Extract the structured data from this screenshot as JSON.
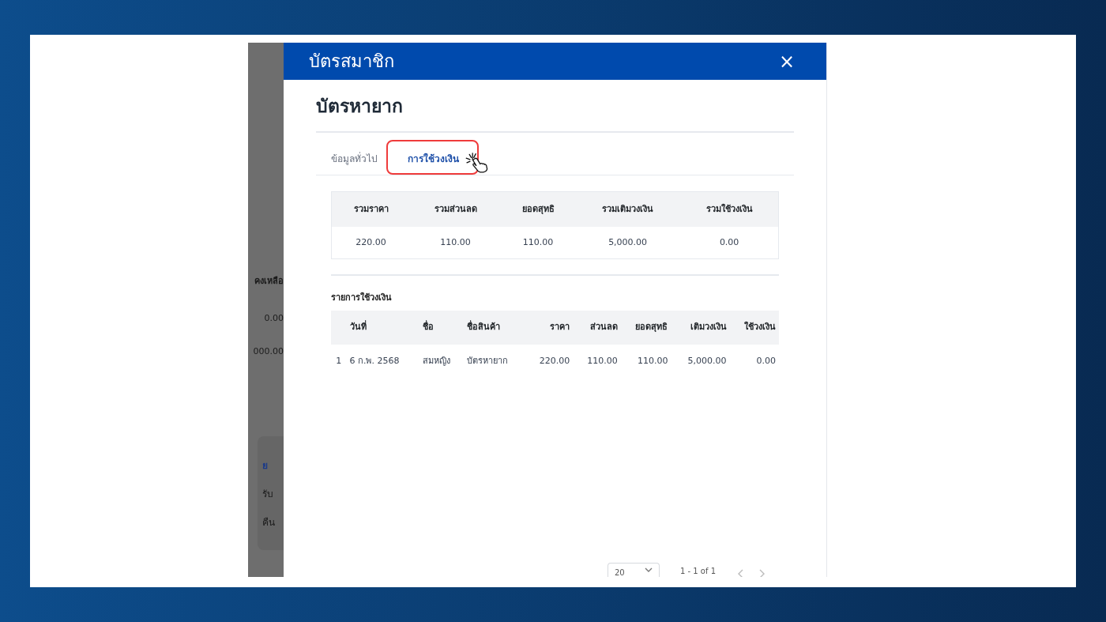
{
  "background_page": {
    "texts": [
      {
        "kind": "heading",
        "text": "คงเหลือ"
      },
      {
        "kind": "cell",
        "text": "0.00"
      },
      {
        "kind": "cell",
        "text": "000.00"
      },
      {
        "kind": "card_title",
        "text": "ย"
      },
      {
        "kind": "card_line",
        "text": "รับ"
      },
      {
        "kind": "card_line",
        "text": "คืน"
      }
    ]
  },
  "modal": {
    "title": "บัตรสมาชิก",
    "close": "×",
    "card_name": "บัตรหายาก"
  },
  "tabs": [
    {
      "label": "ข้อมูลทั่วไป",
      "selected": false,
      "highlighted": false
    },
    {
      "label": "การใช้วงเงิน",
      "selected": true,
      "highlighted": true
    }
  ],
  "summary": {
    "columns": [
      "รวมราคา",
      "รวมส่วนลด",
      "ยอดสุทธิ",
      "รวมเติมวงเงิน",
      "รวมใช้วงเงิน"
    ],
    "values": [
      "220.00",
      "110.00",
      "110.00",
      "5,000.00",
      "0.00"
    ]
  },
  "usage": {
    "title": "รายการใช้วงเงิน",
    "columns": [
      "",
      "วันที่",
      "ชื่อ",
      "ชื่อสินค้า",
      "ราคา",
      "ส่วนลด",
      "ยอดสุทธิ",
      "เติมวงเงิน",
      "ใช้วงเงิน"
    ],
    "rows": [
      [
        "1",
        "6 ก.พ. 2568",
        "สมหญิง",
        "บัตรหายาก",
        "220.00",
        "110.00",
        "110.00",
        "5,000.00",
        "0.00"
      ]
    ]
  },
  "pagination": {
    "page_size": "20",
    "range": "1 - 1 of 1"
  }
}
